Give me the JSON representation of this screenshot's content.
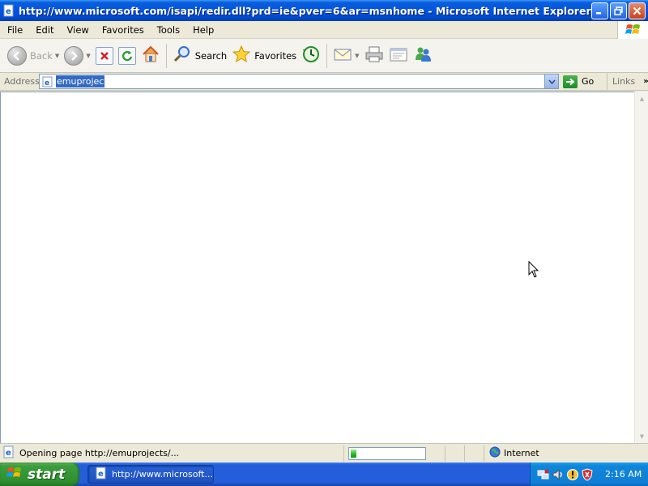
{
  "window": {
    "title": "http://www.microsoft.com/isapi/redir.dll?prd=ie&pver=6&ar=msnhome - Microsoft Internet Explorer"
  },
  "menu": {
    "items": [
      "File",
      "Edit",
      "View",
      "Favorites",
      "Tools",
      "Help"
    ]
  },
  "toolbar": {
    "back_label": "Back",
    "search_label": "Search",
    "favorites_label": "Favorites"
  },
  "address": {
    "label": "Address",
    "value": "emuprojects",
    "go_label": "Go",
    "links_label": "Links"
  },
  "status": {
    "text": "Opening page http://emuprojects/...",
    "progress": 0.08,
    "zone": "Internet"
  },
  "taskbar": {
    "start_label": "start",
    "task_label": "http://www.microsoft...",
    "clock": "2:16 AM"
  },
  "colors": {
    "titlebar": "#0054e3",
    "start": "#3c9e3c",
    "taskbar": "#245edb",
    "selection": "#316ac5"
  },
  "icons": {
    "window": "ie-page-icon",
    "back": "back-arrow-icon",
    "forward": "forward-arrow-icon",
    "stop": "stop-icon",
    "refresh": "refresh-icon",
    "home": "home-icon",
    "search": "search-icon",
    "favorites": "star-icon",
    "history": "history-icon",
    "mail": "mail-icon",
    "print": "print-icon",
    "edit": "edit-icon",
    "messenger": "messenger-icon"
  }
}
